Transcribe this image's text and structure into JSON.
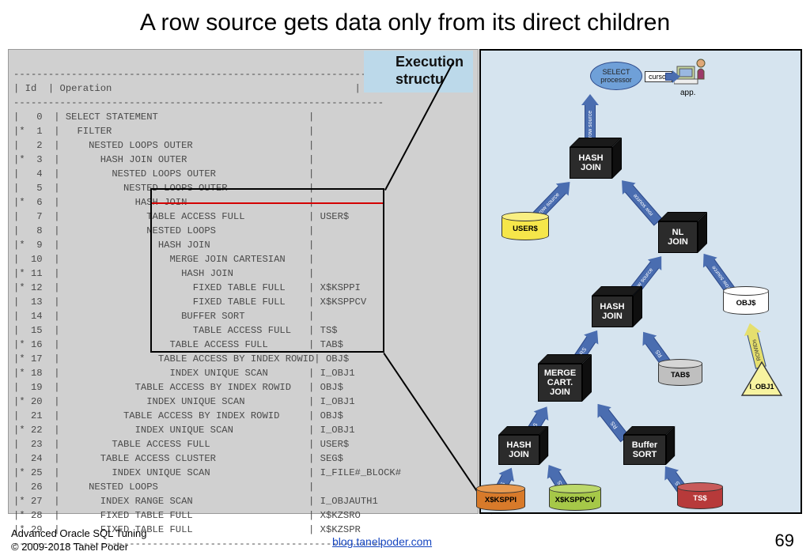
{
  "title": "A row source gets data only from its direct children",
  "exec_label_line1": "Execution",
  "exec_label_line2": "structu",
  "plan": {
    "header_id": "Id",
    "header_op": "Operation",
    "rows": [
      {
        "id": "   0",
        "op": "SELECT STATEMENT",
        "obj": ""
      },
      {
        "id": "*  1",
        "op": "  FILTER",
        "obj": ""
      },
      {
        "id": "   2",
        "op": "    NESTED LOOPS OUTER",
        "obj": ""
      },
      {
        "id": "*  3",
        "op": "      HASH JOIN OUTER",
        "obj": ""
      },
      {
        "id": "   4",
        "op": "        NESTED LOOPS OUTER",
        "obj": ""
      },
      {
        "id": "   5",
        "op": "          NESTED LOOPS OUTER",
        "obj": ""
      },
      {
        "id": "*  6",
        "op": "            HASH JOIN",
        "obj": ""
      },
      {
        "id": "   7",
        "op": "              TABLE ACCESS FULL",
        "obj": "USER$"
      },
      {
        "id": "   8",
        "op": "              NESTED LOOPS",
        "obj": ""
      },
      {
        "id": "*  9",
        "op": "                HASH JOIN",
        "obj": ""
      },
      {
        "id": "  10",
        "op": "                  MERGE JOIN CARTESIAN",
        "obj": ""
      },
      {
        "id": "* 11",
        "op": "                    HASH JOIN",
        "obj": ""
      },
      {
        "id": "* 12",
        "op": "                      FIXED TABLE FULL",
        "obj": "X$KSPPI"
      },
      {
        "id": "  13",
        "op": "                      FIXED TABLE FULL",
        "obj": "X$KSPPCV"
      },
      {
        "id": "  14",
        "op": "                    BUFFER SORT",
        "obj": ""
      },
      {
        "id": "  15",
        "op": "                      TABLE ACCESS FULL",
        "obj": "TS$"
      },
      {
        "id": "* 16",
        "op": "                  TABLE ACCESS FULL",
        "obj": "TAB$"
      },
      {
        "id": "* 17",
        "op": "                TABLE ACCESS BY INDEX ROWID",
        "obj": "OBJ$"
      },
      {
        "id": "* 18",
        "op": "                  INDEX UNIQUE SCAN",
        "obj": "I_OBJ1"
      },
      {
        "id": "  19",
        "op": "            TABLE ACCESS BY INDEX ROWID",
        "obj": "OBJ$"
      },
      {
        "id": "* 20",
        "op": "              INDEX UNIQUE SCAN",
        "obj": "I_OBJ1"
      },
      {
        "id": "  21",
        "op": "          TABLE ACCESS BY INDEX ROWID",
        "obj": "OBJ$"
      },
      {
        "id": "* 22",
        "op": "            INDEX UNIQUE SCAN",
        "obj": "I_OBJ1"
      },
      {
        "id": "  23",
        "op": "        TABLE ACCESS FULL",
        "obj": "USER$"
      },
      {
        "id": "  24",
        "op": "      TABLE ACCESS CLUSTER",
        "obj": "SEG$"
      },
      {
        "id": "* 25",
        "op": "        INDEX UNIQUE SCAN",
        "obj": "I_FILE#_BLOCK#"
      },
      {
        "id": "  26",
        "op": "    NESTED LOOPS",
        "obj": ""
      },
      {
        "id": "* 27",
        "op": "      INDEX RANGE SCAN",
        "obj": "I_OBJAUTH1"
      },
      {
        "id": "* 28",
        "op": "      FIXED TABLE FULL",
        "obj": "X$KZSRO"
      },
      {
        "id": "* 29",
        "op": "      FIXED TABLE FULL",
        "obj": "X$KZSPR"
      }
    ]
  },
  "diagram": {
    "select_processor": "SELECT\nprocessor",
    "cursor": "cursor",
    "app": "app.",
    "nodes": {
      "hash_join_top": "HASH\nJOIN",
      "nl_join": "NL\nJOIN",
      "hash_join_mid": "HASH\nJOIN",
      "merge": "MERGE\nCART.\nJOIN",
      "hash_join_low": "HASH\nJOIN",
      "buffer_sort": "Buffer\nSORT"
    },
    "cyls": {
      "user": "USER$",
      "obj": "OBJ$",
      "tab": "TAB$",
      "iobj1": "I_OBJ1",
      "xksppi": "X$KSPPI",
      "xksppcv": "X$KSPPCV",
      "ts": "TS$"
    },
    "arrow_labels": {
      "row_source": "row source",
      "rs": "RS",
      "rowids": "ROWIDs"
    }
  },
  "footer": {
    "line1": "Advanced Oracle SQL Tuning",
    "line2": "© 2009-2018 Tanel Poder",
    "blog": "blog.tanelpoder.com",
    "page": "69"
  }
}
